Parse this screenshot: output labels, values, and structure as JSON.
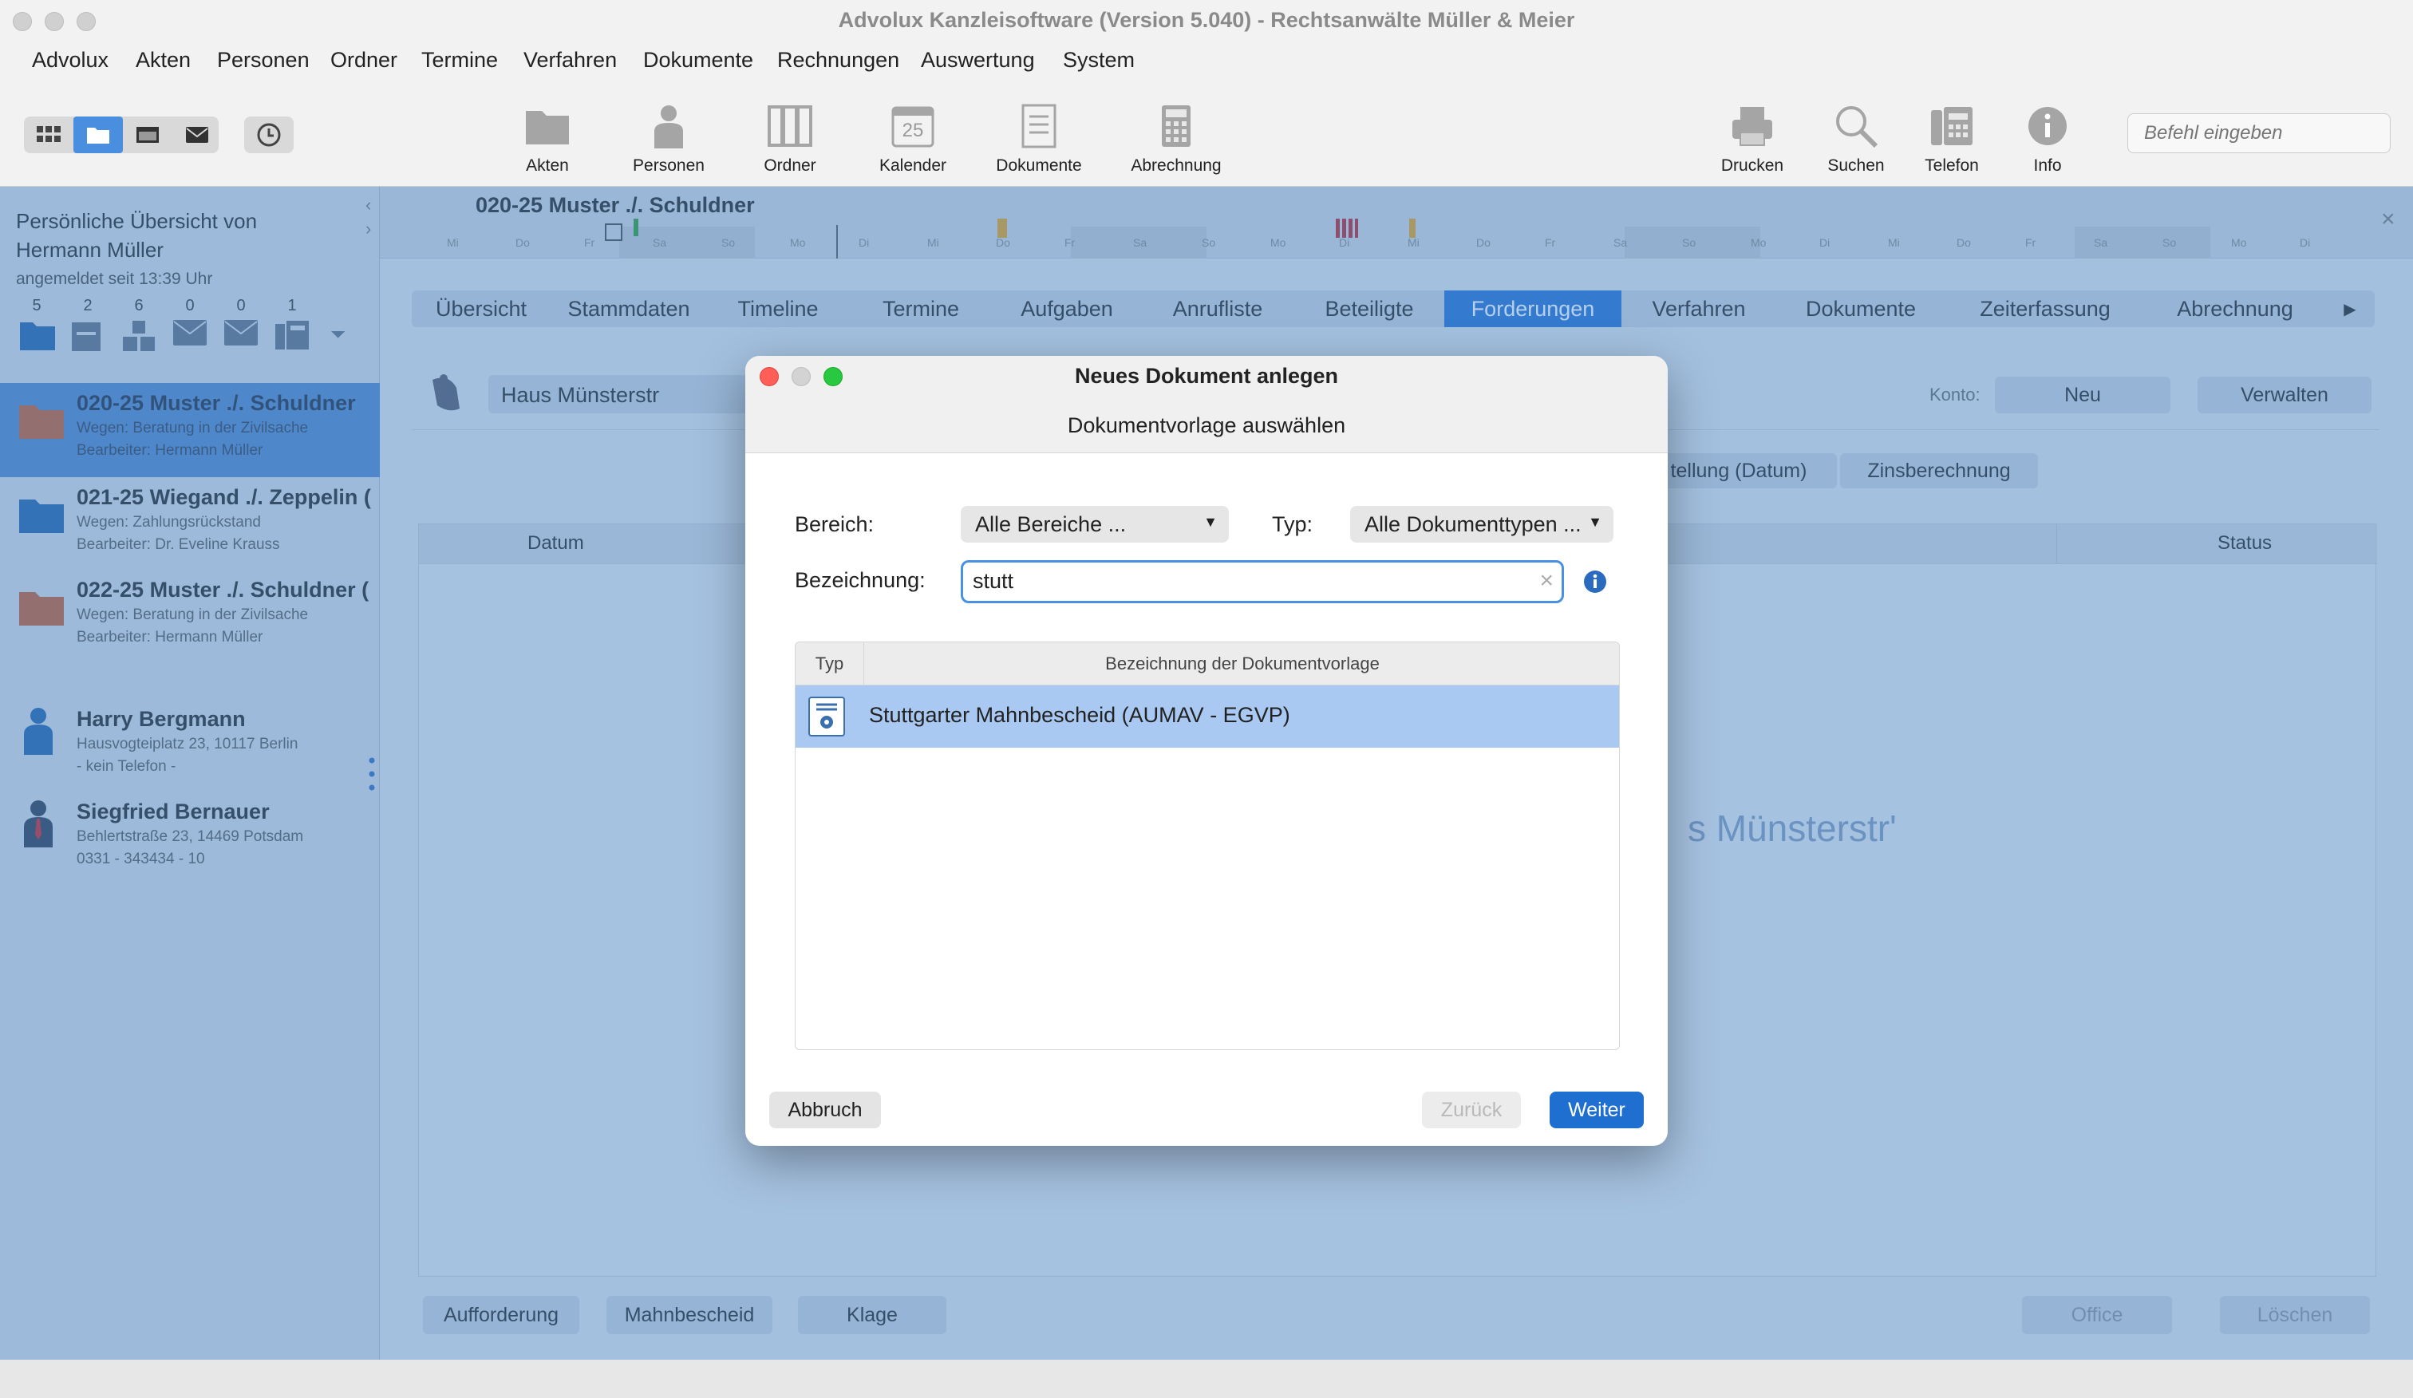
{
  "window": {
    "title": "Advolux Kanzleisoftware (Version 5.040) - Rechtsanwälte Müller & Meier"
  },
  "menu": [
    "Advolux",
    "Akten",
    "Personen",
    "Ordner",
    "Termine",
    "Verfahren",
    "Dokumente",
    "Rechnungen",
    "Auswertung",
    "System"
  ],
  "toolbar": {
    "tools_left": [
      "Akten",
      "Personen",
      "Ordner",
      "Kalender",
      "Dokumente",
      "Abrechnung"
    ],
    "calendar_day": "25",
    "tools_right": [
      "Drucken",
      "Suchen",
      "Telefon",
      "Info"
    ],
    "command_placeholder": "Befehl eingeben"
  },
  "sidebar": {
    "overview_line1": "Persönliche Übersicht von",
    "overview_line2": "Hermann Müller",
    "logged_in": "angemeldet seit 13:39 Uhr",
    "counts": [
      "5",
      "2",
      "6",
      "0",
      "0",
      "1"
    ],
    "cases": [
      {
        "title": "020-25 Muster ./. Schuldner",
        "wegen": "Wegen: Beratung in der Zivilsache",
        "bearbeiter": "Bearbeiter: Hermann Müller"
      },
      {
        "title": "021-25 Wiegand ./. Zeppelin (",
        "wegen": "Wegen: Zahlungsrückstand",
        "bearbeiter": "Bearbeiter: Dr. Eveline Krauss"
      },
      {
        "title": "022-25 Muster ./. Schuldner (",
        "wegen": "Wegen: Beratung in der Zivilsache",
        "bearbeiter": "Bearbeiter: Hermann Müller"
      }
    ],
    "persons": [
      {
        "name": "Harry Bergmann",
        "address": "Hausvogteiplatz 23, 10117 Berlin",
        "phone": "- kein Telefon -"
      },
      {
        "name": "Siegfried Bernauer",
        "address": "Behlertstraße 23, 14469 Potsdam",
        "phone": "0331 - 343434 - 10"
      }
    ]
  },
  "main": {
    "case_heading": "020-25 Muster ./. Schuldner",
    "timeline_days": [
      "Mi",
      "Do",
      "Fr",
      "Sa",
      "So",
      "Mo",
      "Di",
      "Mi",
      "Do",
      "Fr",
      "Sa",
      "So",
      "Mo",
      "Di",
      "Mi",
      "Do",
      "Fr",
      "Sa",
      "So",
      "Mo",
      "Di",
      "Mi",
      "Do",
      "Fr",
      "Sa",
      "So",
      "Mo",
      "Di"
    ],
    "tabs": [
      "Übersicht",
      "Stammdaten",
      "Timeline",
      "Termine",
      "Aufgaben",
      "Anrufliste",
      "Beteiligte",
      "Forderungen",
      "Verfahren",
      "Dokumente",
      "Zeiterfassung",
      "Abrechnung"
    ],
    "active_tab": "Forderungen",
    "claim_name": "Haus Münsterstr",
    "konto_label": "Konto:",
    "neu_button": "Neu",
    "verwalten_button": "Verwalten",
    "subtab_partial": "tellung (Datum)",
    "subtab_zins": "Zinsberechnung",
    "col_datum": "Datum",
    "col_status": "Status",
    "empty_text_partial": "s Münsterstr'",
    "bottom_buttons": [
      "Aufforderung",
      "Mahnbescheid",
      "Klage"
    ],
    "office_button": "Office",
    "loeschen_button": "Löschen"
  },
  "dialog": {
    "title": "Neues Dokument anlegen",
    "subtitle": "Dokumentvorlage auswählen",
    "bereich_label": "Bereich:",
    "bereich_value": "Alle Bereiche ...",
    "typ_label": "Typ:",
    "typ_value": "Alle Dokumenttypen ...",
    "bezeichnung_label": "Bezeichnung:",
    "bezeichnung_value": "stutt",
    "table_headers": [
      "Typ",
      "Bezeichnung der Dokumentvorlage"
    ],
    "rows": [
      {
        "name": "Stuttgarter Mahnbescheid (AUMAV - EGVP)"
      }
    ],
    "btn_abbruch": "Abbruch",
    "btn_zurueck": "Zurück",
    "btn_weiter": "Weiter"
  },
  "colors": {
    "accent": "#1f6fd0",
    "selection": "#a9c9f3",
    "overlay": "#508ccd"
  }
}
